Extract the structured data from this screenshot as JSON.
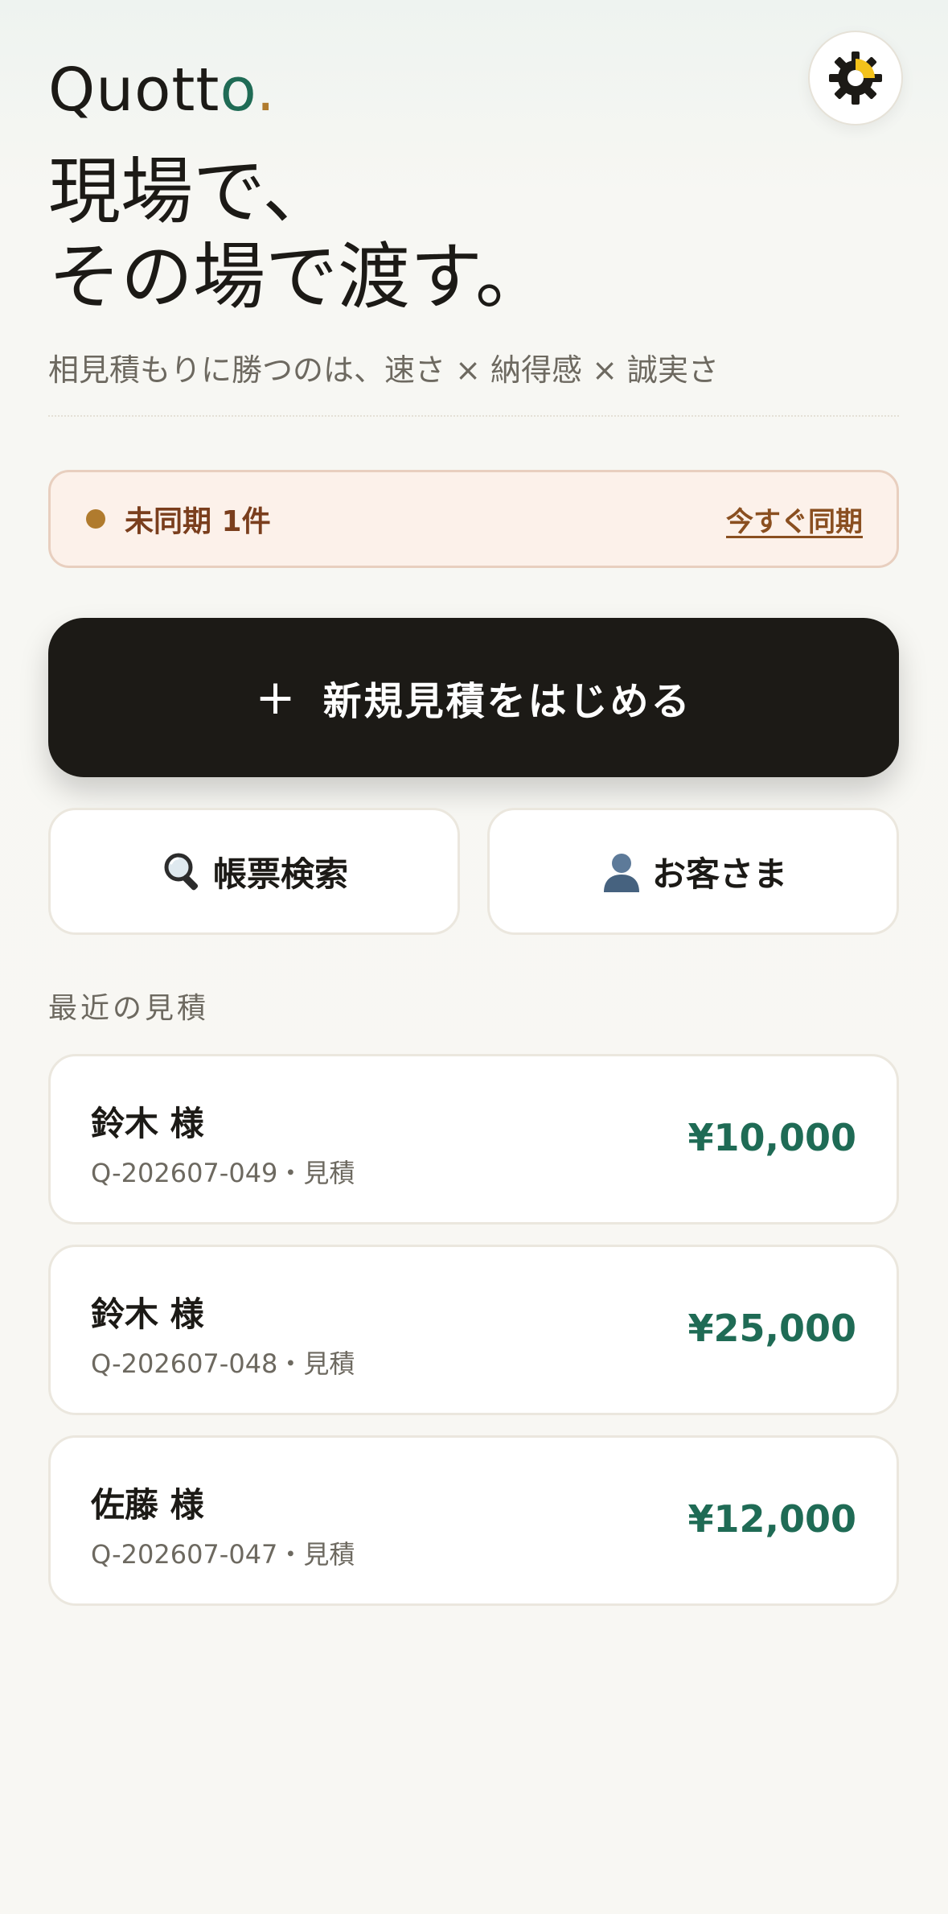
{
  "app": {
    "logo_main": "Quott",
    "logo_o": "o",
    "logo_dot": "."
  },
  "header": {
    "theme_toggle_icon": "sun-gear-icon"
  },
  "hero": {
    "line1": "現場で、",
    "line2": "その場で渡す。",
    "tagline": "相見積もりに勝つのは、速さ × 納得感 × 誠実さ"
  },
  "sync": {
    "status": "未同期 1件",
    "action": "今すぐ同期",
    "dot_color": "#b07b2e"
  },
  "actions": {
    "new_quote_plus": "+",
    "new_quote_label": "新規見積をはじめる",
    "search_icon": "magnifier-icon",
    "search_label": "帳票検索",
    "customers_icon": "person-icon",
    "customers_label": "お客さま"
  },
  "recent": {
    "title": "最近の見積",
    "items": [
      {
        "name": "鈴木 様",
        "meta": "Q-202607-049・見積",
        "amount": "¥10,000"
      },
      {
        "name": "鈴木 様",
        "meta": "Q-202607-048・見積",
        "amount": "¥25,000"
      },
      {
        "name": "佐藤 様",
        "meta": "Q-202607-047・見積",
        "amount": "¥12,000"
      }
    ]
  },
  "colors": {
    "brand_dark": "#1c1a16",
    "accent_green": "#1f6b55",
    "accent_gold": "#b07b2e",
    "sync_bg": "#fcf1ea"
  }
}
